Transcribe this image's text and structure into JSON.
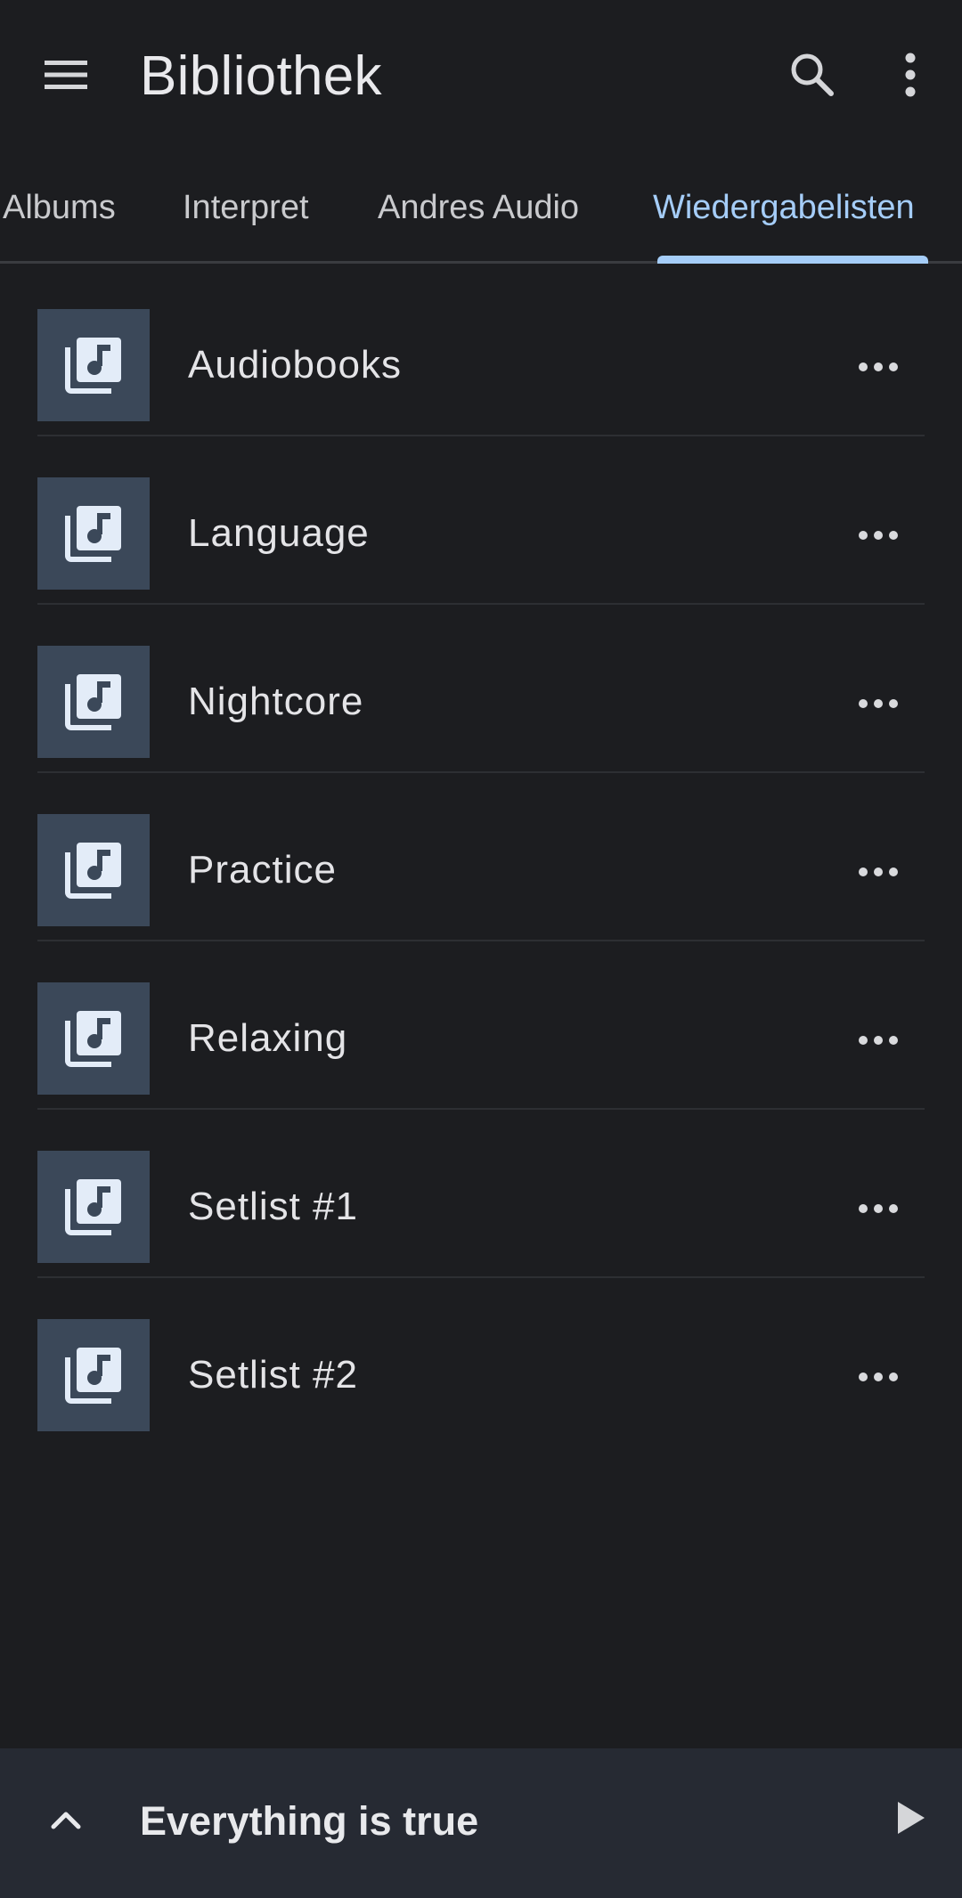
{
  "header": {
    "title": "Bibliothek",
    "menu_icon": "menu-icon",
    "search_icon": "search-icon",
    "overflow_icon": "more-vert-icon"
  },
  "tabs": [
    {
      "label": "Albums",
      "active": false
    },
    {
      "label": "Interpret",
      "active": false
    },
    {
      "label": "Andres Audio",
      "active": false
    },
    {
      "label": "Wiedergabelisten",
      "active": true
    }
  ],
  "playlists": [
    {
      "name": "Audiobooks",
      "icon": "playlist-music-icon"
    },
    {
      "name": "Language",
      "icon": "playlist-music-icon"
    },
    {
      "name": "Nightcore",
      "icon": "playlist-music-icon"
    },
    {
      "name": "Practice",
      "icon": "playlist-music-icon"
    },
    {
      "name": "Relaxing",
      "icon": "playlist-music-icon"
    },
    {
      "name": "Setlist #1",
      "icon": "playlist-music-icon"
    },
    {
      "name": "Setlist #2",
      "icon": "playlist-music-icon"
    }
  ],
  "now_playing": {
    "title": "Everything is true",
    "expand_icon": "chevron-up-icon",
    "play_icon": "play-icon"
  },
  "colors": {
    "background": "#1c1d20",
    "accent": "#a5cdf8",
    "thumb_bg": "#3b4859",
    "mini_player_bg": "#262a33"
  }
}
